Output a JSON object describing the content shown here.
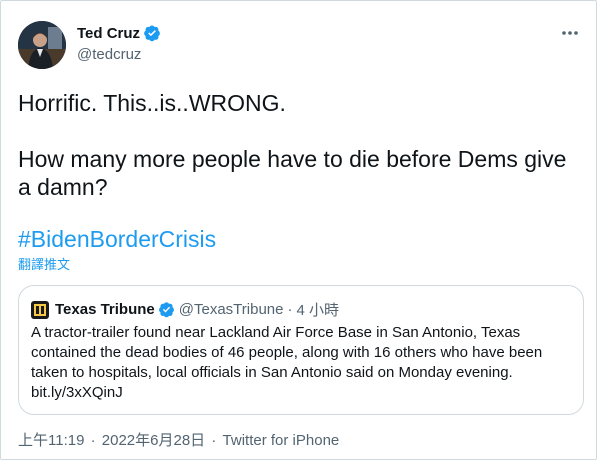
{
  "author": {
    "name": "Ted Cruz",
    "handle": "@tedcruz"
  },
  "tweet": {
    "text": "Horrific. This..is..WRONG.\n\nHow many more people have to die before Dems give a damn?",
    "hashtag": "#BidenBorderCrisis",
    "translate_label": "翻譯推文"
  },
  "quoted": {
    "name": "Texas Tribune",
    "handle": "@TexasTribune",
    "dot": "·",
    "time": "4 小時",
    "text": "A tractor-trailer found near Lackland Air Force Base in San Antonio, Texas contained the dead bodies of 46 people, along with 16 others who have been taken to hospitals, local officials in San Antonio said on Monday evening. bit.ly/3xXQinJ"
  },
  "footer": {
    "time": "上午11:19",
    "sep1": "·",
    "date": "2022年6月28日",
    "sep2": "·",
    "source": "Twitter for iPhone"
  },
  "colors": {
    "link": "#1d9bf0",
    "secondary_text": "#536471",
    "primary_text": "#0f1419",
    "border": "#cfd9de"
  },
  "icons": {
    "verified": "verified-badge-icon",
    "more": "more-horizontal-icon",
    "quoted_logo": "texas-tribune-logo-icon"
  }
}
